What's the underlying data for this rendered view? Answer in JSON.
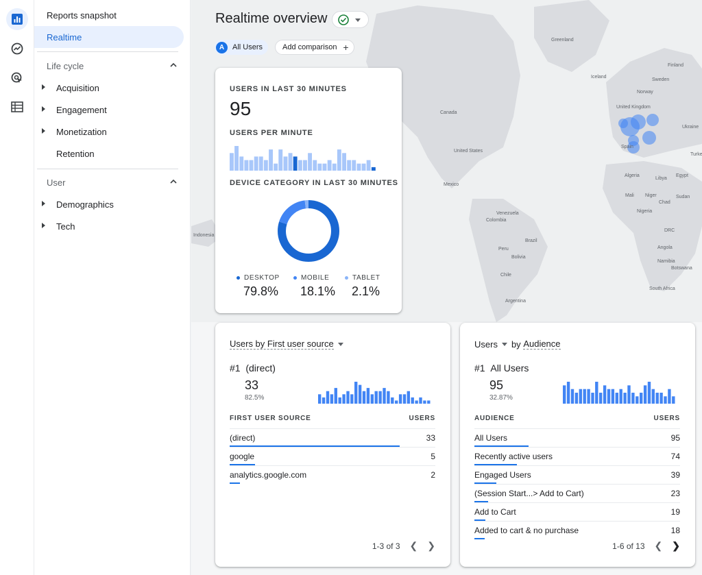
{
  "nav": {
    "reports_snapshot": "Reports snapshot",
    "realtime": "Realtime",
    "lifecycle": {
      "title": "Life cycle",
      "items": [
        "Acquisition",
        "Engagement",
        "Monetization",
        "Retention"
      ]
    },
    "user": {
      "title": "User",
      "items": [
        "Demographics",
        "Tech"
      ]
    }
  },
  "rail_icons": [
    "reports-icon",
    "explore-icon",
    "advertising-icon",
    "configure-icon"
  ],
  "header": {
    "title": "Realtime overview",
    "all_users_chip": "All Users",
    "all_users_avatar": "A",
    "add_comparison": "Add comparison"
  },
  "map_labels": [
    "Greenland",
    "Iceland",
    "Finland",
    "Sweden",
    "Norway",
    "United Kingdom",
    "Ukraine",
    "Spain",
    "Turkey",
    "Canada",
    "United States",
    "Mexico",
    "Venezuela",
    "Colombia",
    "Brazil",
    "Peru",
    "Bolivia",
    "Chile",
    "Argentina",
    "Algeria",
    "Libya",
    "Egypt",
    "Mali",
    "Niger",
    "Chad",
    "Sudan",
    "Nigeria",
    "DRC",
    "Angola",
    "Namibia",
    "Botswana",
    "South Africa",
    "Indonesia"
  ],
  "users_card": {
    "users_label": "USERS IN LAST 30 MINUTES",
    "users_value": "95",
    "per_minute_label": "USERS PER MINUTE",
    "per_minute": [
      5,
      7,
      4,
      3,
      3,
      4,
      4,
      3,
      6,
      2,
      6,
      4,
      5,
      4,
      3,
      3,
      5,
      3,
      2,
      2,
      3,
      2,
      6,
      5,
      3,
      3,
      2,
      2,
      3,
      1
    ],
    "device_label": "DEVICE CATEGORY IN LAST 30 MINUTES",
    "devices": [
      {
        "name": "DESKTOP",
        "value": "79.8%",
        "pct": 79.8,
        "color": "#1967d2"
      },
      {
        "name": "MOBILE",
        "value": "18.1%",
        "pct": 18.1,
        "color": "#4285f4"
      },
      {
        "name": "TABLET",
        "value": "2.1%",
        "pct": 2.1,
        "color": "#8ab4f8"
      }
    ]
  },
  "source_card": {
    "head_metric": "Users by First user source",
    "rank": "#1",
    "rank_name": "(direct)",
    "rank_value": "33",
    "rank_pct": "82.5%",
    "mini": [
      3,
      2,
      4,
      3,
      5,
      2,
      3,
      4,
      3,
      7,
      6,
      4,
      5,
      3,
      4,
      4,
      5,
      4,
      2,
      1,
      3,
      3,
      4,
      2,
      1,
      2,
      1,
      1
    ],
    "col_left": "FIRST USER SOURCE",
    "col_right": "USERS",
    "rows": [
      {
        "label": "(direct)",
        "value": "33",
        "frac": 1.0
      },
      {
        "label": "google",
        "value": "5",
        "frac": 0.15
      },
      {
        "label": "analytics.google.com",
        "value": "2",
        "frac": 0.06
      }
    ],
    "pager": "1-3 of 3"
  },
  "audience_card": {
    "head_metric": "Users",
    "head_by": "by",
    "head_dim": "Audience",
    "rank": "#1",
    "rank_name": "All Users",
    "rank_value": "95",
    "rank_pct": "32.87%",
    "mini": [
      5,
      6,
      4,
      3,
      4,
      4,
      4,
      3,
      6,
      3,
      5,
      4,
      4,
      3,
      4,
      3,
      5,
      3,
      2,
      3,
      5,
      6,
      4,
      3,
      3,
      2,
      4,
      2
    ],
    "col_left": "AUDIENCE",
    "col_right": "USERS",
    "rows": [
      {
        "label": "All Users",
        "value": "95",
        "frac": 0.32
      },
      {
        "label": "Recently active users",
        "value": "74",
        "frac": 0.25
      },
      {
        "label": "Engaged Users",
        "value": "39",
        "frac": 0.13
      },
      {
        "label": "(Session Start...> Add to Cart)",
        "value": "23",
        "frac": 0.08
      },
      {
        "label": "Add to Cart",
        "value": "19",
        "frac": 0.065
      },
      {
        "label": "Added to cart & no purchase",
        "value": "18",
        "frac": 0.06
      }
    ],
    "pager": "1-6 of 13"
  }
}
